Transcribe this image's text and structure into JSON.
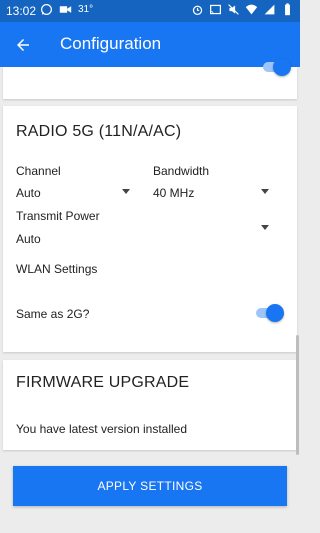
{
  "status_bar": {
    "time": "13:02",
    "temperature": "31°",
    "icons_left": [
      "whatsapp-icon",
      "video-icon"
    ],
    "icons_right": [
      "alarm-icon",
      "cast-icon",
      "mute-icon",
      "wifi-icon",
      "signal-icon",
      "battery-icon"
    ]
  },
  "app_bar": {
    "title": "Configuration",
    "back_icon": "arrow-back-icon"
  },
  "radio_5g": {
    "title": "RADIO 5G (11N/A/AC)",
    "channel_label": "Channel",
    "channel_value": "Auto",
    "bandwidth_label": "Bandwidth",
    "bandwidth_value": "40 MHz",
    "transmit_power_label": "Transmit Power",
    "transmit_power_value": "Auto",
    "wlan_settings_label": "WLAN Settings",
    "same_as_2g_label": "Same as 2G?",
    "same_as_2g_on": true
  },
  "firmware": {
    "title": "FIRMWARE UPGRADE",
    "status": "You have latest version installed"
  },
  "actions": {
    "apply_label": "APPLY SETTINGS"
  },
  "colors": {
    "primary": "#1976f2",
    "status_bar": "#1565c0",
    "background": "#ececec"
  }
}
